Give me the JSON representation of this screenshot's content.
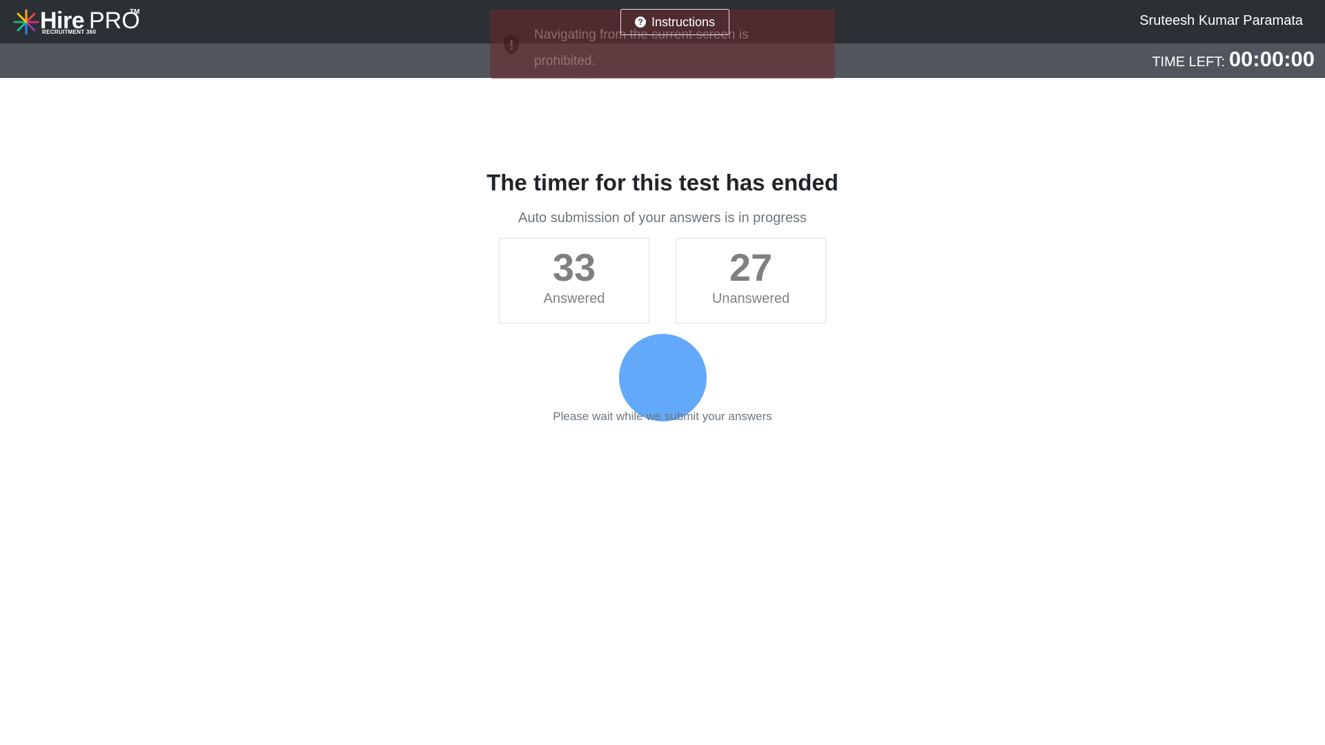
{
  "header": {
    "logo": {
      "brand_bold": "Hire",
      "brand_light": "PRO",
      "trademark": "TM",
      "tagline": "RECRUITMENT 360"
    },
    "instructions_label": "Instructions",
    "user_name": "Sruteesh Kumar Paramata",
    "time_left_label": "TIME LEFT:",
    "time_left_value": "00:00:00"
  },
  "toast": {
    "icon": "shield-icon",
    "message": "Navigating from the current screen is prohibited."
  },
  "main": {
    "title": "The timer for this test has ended",
    "subtitle": "Auto submission of your answers is in progress",
    "stats": {
      "answered": {
        "count": "33",
        "label": "Answered"
      },
      "unanswered": {
        "count": "27",
        "label": "Unanswered"
      }
    },
    "wait_message": "Please wait while we submit your answers"
  },
  "colors": {
    "header_bg": "#2b3035",
    "subheader_bg": "#50565c",
    "spinner": "#63a9fa",
    "toast_bg": "#6e282c"
  }
}
